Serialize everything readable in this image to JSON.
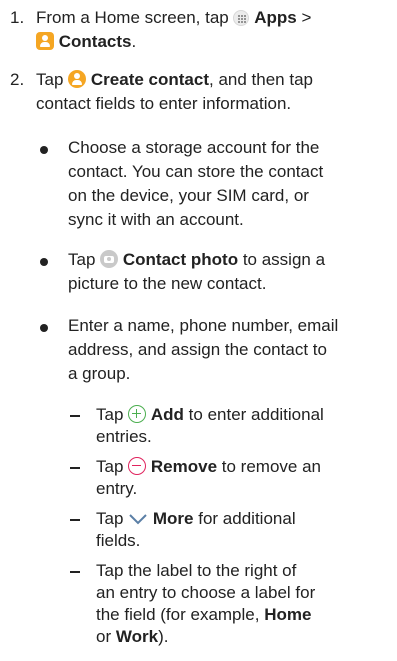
{
  "step1": {
    "number": "1.",
    "prefix": "From a Home screen, tap",
    "apps": "Apps",
    "sep": ">",
    "contacts": "Contacts",
    "end": "."
  },
  "step2": {
    "number": "2.",
    "prefix": "Tap",
    "create": "Create contact",
    "rest1": ", and then tap",
    "line2": "contact fields to enter information."
  },
  "bullet1": {
    "l1": "Choose a storage account for the",
    "l2": "contact. You can store the contact",
    "l3": "on the device, your SIM card, or",
    "l4": "sync it with an account."
  },
  "bullet2": {
    "prefix": "Tap",
    "photo": "Contact photo",
    "rest1": "to assign a",
    "l2": "picture to the new contact."
  },
  "bullet3": {
    "l1": "Enter a name, phone number, email",
    "l2": "address, and assign the contact to",
    "l3": "a group."
  },
  "sub1": {
    "prefix": "Tap",
    "label": "Add",
    "rest1": "to enter additional",
    "l2": "entries."
  },
  "sub2": {
    "prefix": "Tap",
    "label": "Remove",
    "rest1": "to remove an",
    "l2": "entry."
  },
  "sub3": {
    "prefix": "Tap",
    "label": "More",
    "rest1": "for additional",
    "l2": "fields."
  },
  "sub4": {
    "l1": "Tap the label to the right of",
    "l2": "an entry to choose a label for",
    "l3a": "the field (for example,",
    "home": "Home",
    "l4a": "or",
    "work": "Work",
    "l4b": ")."
  }
}
